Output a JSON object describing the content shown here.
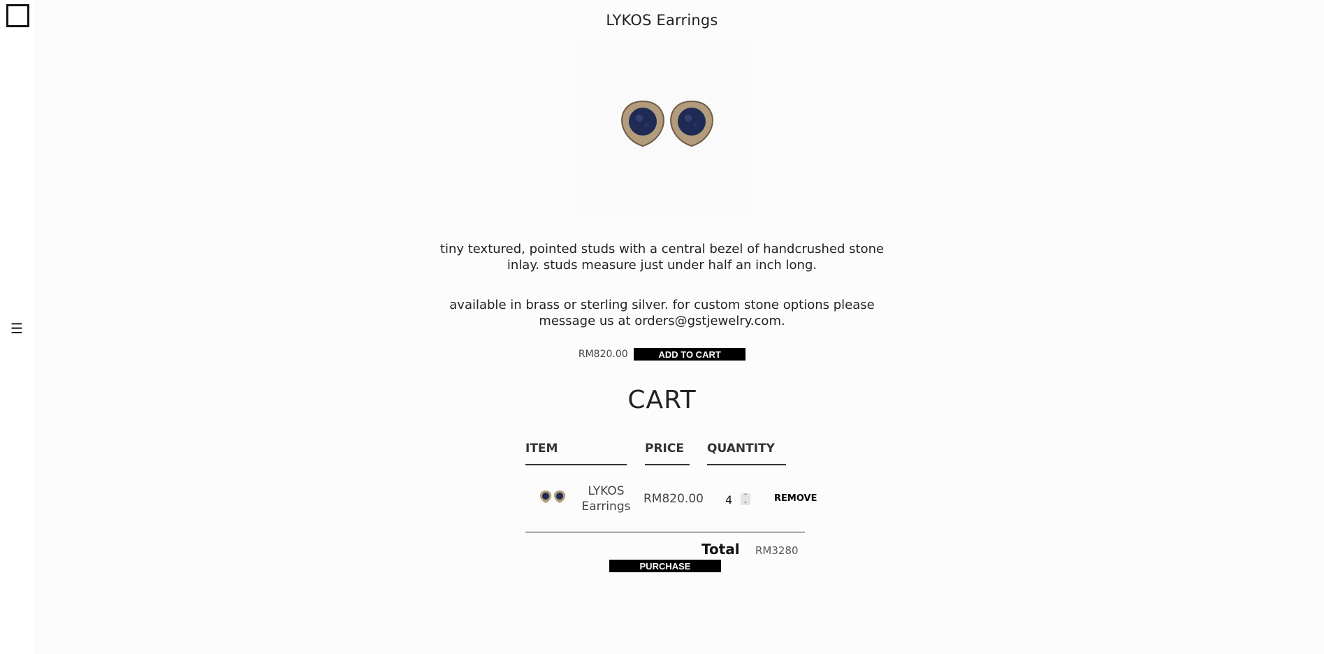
{
  "product": {
    "title": "LYKOS Earrings",
    "description_1": "tiny textured, pointed studs with a central bezel of handcrushed stone inlay. studs measure just under half an inch long.",
    "description_2": "available in brass or sterling silver. for custom stone options please message us at orders@gstjewelry.com.",
    "price": "RM820.00",
    "add_to_cart_label": "ADD TO CART"
  },
  "nav": {
    "menu_icon": "hamburger-icon",
    "logo_icon": "square-logo-icon"
  },
  "cart": {
    "heading": "CART",
    "columns": {
      "item": "ITEM",
      "price": "PRICE",
      "quantity": "QUANTITY"
    },
    "rows": [
      {
        "name": "LYKOS Earrings",
        "price": "RM820.00",
        "quantity": "4",
        "remove_label": "REMOVE"
      }
    ],
    "total_label": "Total",
    "total_value": "RM3280",
    "purchase_label": "PURCHASE"
  },
  "colors": {
    "button_bg": "#000000",
    "button_text": "#ffffff",
    "stone": "#1f2a55",
    "metal": "#a8927a"
  }
}
